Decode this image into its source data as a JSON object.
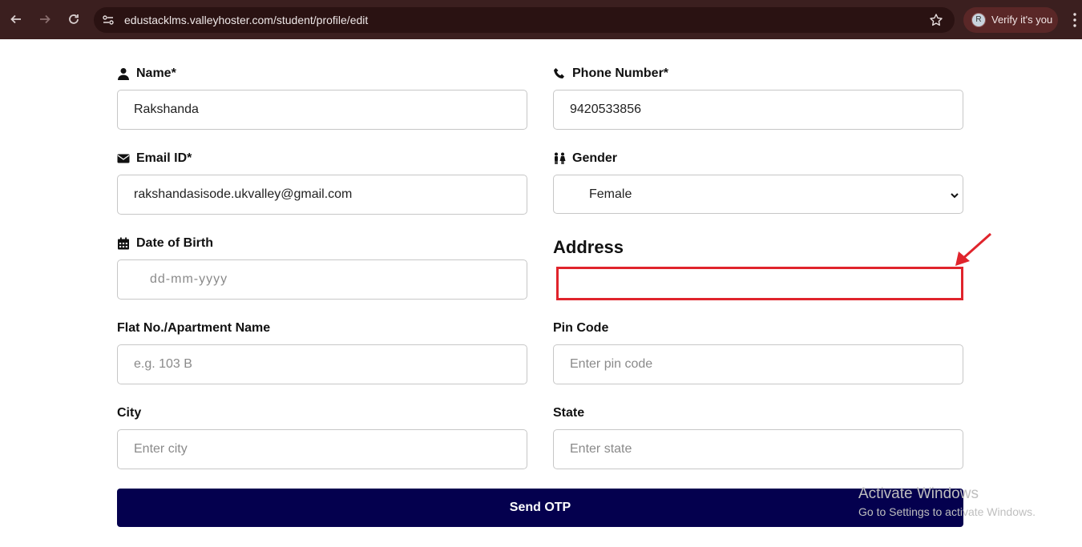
{
  "browser": {
    "url": "edustacklms.valleyhoster.com/student/profile/edit",
    "profile_initial": "R",
    "verify_label": "Verify it's you"
  },
  "form": {
    "name": {
      "label": "Name*",
      "value": "Rakshanda",
      "icon": "user-icon"
    },
    "phone": {
      "label": "Phone Number*",
      "value": "9420533856",
      "icon": "phone-icon"
    },
    "email": {
      "label": "Email ID*",
      "value": "rakshandasisode.ukvalley@gmail.com",
      "icon": "envelope-icon"
    },
    "gender": {
      "label": "Gender",
      "selected": "Female",
      "icon": "restroom-icon"
    },
    "dob": {
      "label": "Date of Birth",
      "placeholder": "dd-mm-yyyy",
      "icon": "calendar-icon"
    },
    "address_heading": "Address",
    "flat": {
      "label": "Flat No./Apartment Name",
      "placeholder": "e.g. 103 B"
    },
    "pincode": {
      "label": "Pin Code",
      "placeholder": "Enter pin code"
    },
    "city": {
      "label": "City",
      "placeholder": "Enter city"
    },
    "state": {
      "label": "State",
      "placeholder": "Enter state"
    },
    "submit_label": "Send OTP"
  },
  "annotation": {
    "color": "#e0242c"
  },
  "watermark": {
    "title": "Activate Windows",
    "subtitle": "Go to Settings to activate Windows."
  },
  "colors": {
    "topbar": "#3b1f1f",
    "button": "#04004e"
  }
}
